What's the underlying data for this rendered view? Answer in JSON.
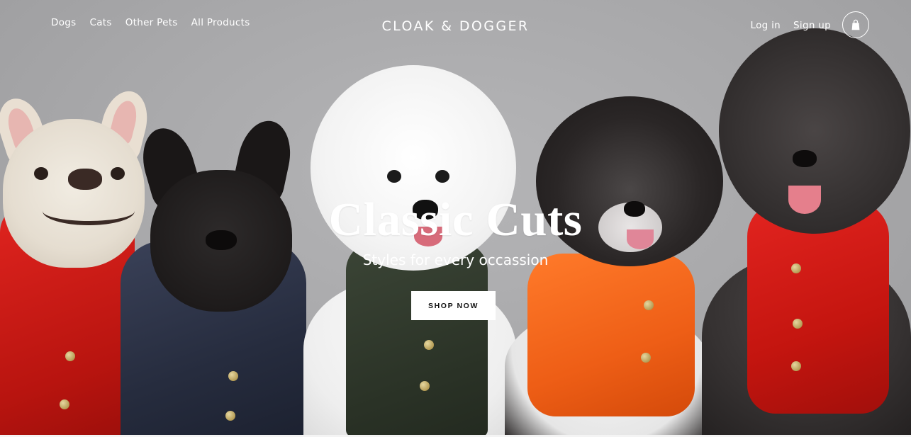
{
  "header": {
    "nav_left": [
      "Dogs",
      "Cats",
      "Other Pets",
      "All Products"
    ],
    "brand": "CLOAK & DOGGER",
    "login_label": "Log in",
    "signup_label": "Sign up",
    "cart_icon": "shopping-bag-icon"
  },
  "hero": {
    "title": "Classic Cuts",
    "subtitle": "Styles for every occassion",
    "cta_label": "SHOP NOW",
    "image_description_colors": {
      "background": "#a9a9ab",
      "vest_red": "#d81c17",
      "vest_navy": "#262c3e",
      "vest_green": "#2a3226",
      "vest_orange": "#ee5e16"
    }
  }
}
